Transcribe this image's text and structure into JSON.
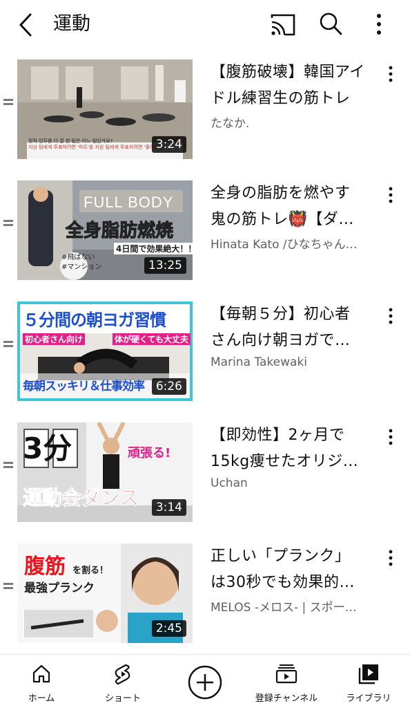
{
  "header": {
    "title": "運動"
  },
  "videos": [
    {
      "title_line1": "【腹筋破壊】韓国アイ",
      "title_line2": "ドル練習生の筋トレ",
      "channel": "たなか.",
      "duration": "3:24",
      "thumb_caption1": "정작 인무를 더 잘 한 팀은 어느 팀인가요?",
      "thumb_caption2": "지선 팀에게 투표하려면 '하트'를 지원 팀에게 투표하려면 '좋아요'를"
    },
    {
      "title_line1": "全身の脂肪を燃やす",
      "title_line2": "鬼の筋トレ👹【ダ…",
      "channel": "Hinata Kato /ひなちゃん…",
      "duration": "13:25",
      "thumb_text1": "FULL BODY",
      "thumb_text2": "全身脂肪燃焼",
      "thumb_text3": "4日間で効果絶大！！",
      "thumb_text4": "#飛ばない",
      "thumb_text5": "#マンション"
    },
    {
      "title_line1": "【毎朝５分】初心者",
      "title_line2": "さん向け朝ヨガで…",
      "channel": "Marina Takewaki",
      "duration": "6:26",
      "thumb_text1": "５分間の朝ヨガ習慣",
      "thumb_text2": "初心者さん向け",
      "thumb_text3": "体が硬くても大丈夫",
      "thumb_text4": "毎朝スッキリ＆仕事効率"
    },
    {
      "title_line1": "【即効性】2ヶ月で",
      "title_line2": "15kg痩せたオリジ…",
      "channel": "Uchan",
      "duration": "3:14",
      "thumb_text1": "3分",
      "thumb_text2": "頑張る!",
      "thumb_text3": "運動会ダンス"
    },
    {
      "title_line1": "正しい「プランク」",
      "title_line2": "は30秒でも効果的…",
      "channel": "MELOS -メロス- | スポー…",
      "duration": "2:45",
      "thumb_text1": "腹筋",
      "thumb_text2": "を割る！",
      "thumb_text3": "最強プランク"
    }
  ],
  "bottom_nav": {
    "home": "ホーム",
    "shorts": "ショート",
    "subscriptions": "登録チャンネル",
    "library": "ライブラリ"
  }
}
